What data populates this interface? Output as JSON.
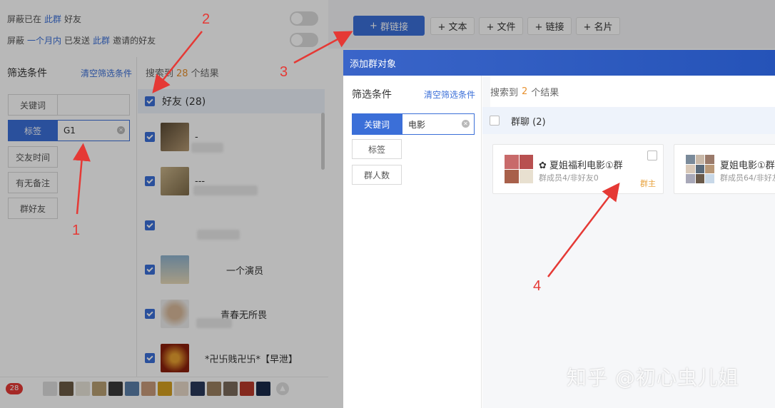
{
  "privacy": {
    "row1": {
      "prefix": "屏蔽已在",
      "link": "此群",
      "suffix": "好友"
    },
    "row2": {
      "prefix": "屏蔽",
      "link1": "一个月内",
      "mid": "已发送",
      "link2": "此群",
      "suffix": "邀请的好友"
    }
  },
  "left_filter": {
    "title": "筛选条件",
    "clear": "清空筛选条件",
    "buttons": [
      "关键词",
      "标签",
      "交友时间",
      "有无备注",
      "群好友"
    ],
    "active": "标签",
    "tag_value": "G1"
  },
  "friend_list": {
    "result_prefix": "搜索到",
    "result_count": "28",
    "result_suffix": "个结果",
    "group_label": "好友 (28)",
    "friends": [
      {
        "name": "-"
      },
      {
        "name": "---"
      },
      {
        "name": ""
      },
      {
        "name": "一个演员"
      },
      {
        "name": "青春无所畏"
      },
      {
        "name": "*卍卐贱卍卐*【早泄】"
      }
    ]
  },
  "bottom_bar": {
    "badge": "28"
  },
  "toolbar": {
    "group_link": "群链接",
    "text": "+ 文本",
    "file": "+ 文件",
    "link": "+ 链接",
    "card": "+ 名片"
  },
  "modal": {
    "title": "添加群对象",
    "filter_title": "筛选条件",
    "clear": "清空筛选条件",
    "buttons": [
      "关键词",
      "标签",
      "群人数"
    ],
    "keyword_value": "电影",
    "result_prefix": "搜索到",
    "result_count": "2",
    "result_suffix": "个结果",
    "group_label": "群聊 (2)",
    "groups": [
      {
        "name": "夏姐福利电影①群",
        "meta": "群成员4/非好友0",
        "role": "群主"
      },
      {
        "name": "夏姐电影①群",
        "meta": "群成员64/非好友",
        "role": ""
      }
    ]
  },
  "watermark": "知乎 @初心虫儿姐",
  "annotations": [
    "1",
    "2",
    "3",
    "4"
  ],
  "colors": {
    "accent": "#3b6fd8",
    "count": "#e8912f",
    "arrow": "#e53935"
  }
}
